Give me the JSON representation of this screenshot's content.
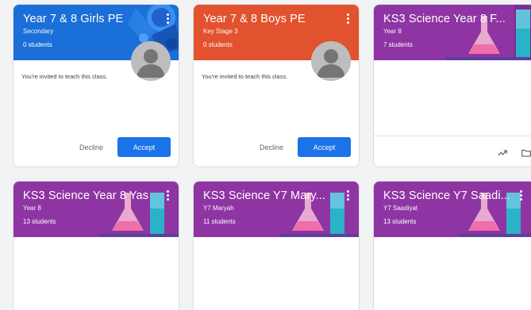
{
  "colors": {
    "girls_pe": "#1a6fd8",
    "boys_pe": "#e2522e",
    "science": "#8e35a3",
    "accept": "#1a73e8"
  },
  "invited_cards": [
    {
      "title": "Year 7 & 8 Girls PE",
      "section": "Secondary",
      "students": "0 students",
      "invite_text": "You're invited to teach this class.",
      "decline_label": "Decline",
      "accept_label": "Accept"
    },
    {
      "title": "Year 7 & 8 Boys PE",
      "section": "Key Stage 3",
      "students": "0 students",
      "invite_text": "You're invited to teach this class.",
      "decline_label": "Decline",
      "accept_label": "Accept"
    }
  ],
  "class_cards": [
    {
      "title": "KS3 Science Year 8 F...",
      "section": "Year 8",
      "students": "7 students"
    },
    {
      "title": "KS3 Science Year 8 Yas",
      "section": "Year 8",
      "students": "13 students"
    },
    {
      "title": "KS3 Science Y7 Mary...",
      "section": "Y7 Maryah",
      "students": "11 students"
    },
    {
      "title": "KS3 Science Y7 Saadi...",
      "section": "Y7 Saadiyat",
      "students": "13 students"
    }
  ],
  "icons": {
    "more": "more-vert-icon",
    "avatar": "person-avatar-icon",
    "trend": "trending-up-icon",
    "folder": "folder-icon"
  }
}
